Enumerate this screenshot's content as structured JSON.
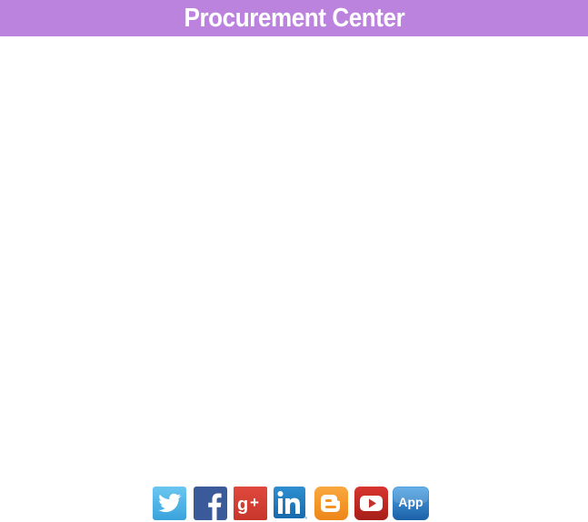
{
  "header": {
    "title": "Procurement Center",
    "background_color": "#bb82de",
    "text_color": "#ffffff"
  },
  "social_links": [
    {
      "name": "twitter",
      "icon": "twitter-icon",
      "color": "#4fb4e6"
    },
    {
      "name": "facebook",
      "icon": "facebook-icon",
      "color": "#3b5a9a"
    },
    {
      "name": "google-plus",
      "icon": "google-plus-icon",
      "color": "#d73d32",
      "label": "g+"
    },
    {
      "name": "linkedin",
      "icon": "linkedin-icon",
      "color": "#1f7bbf",
      "label": "in"
    },
    {
      "name": "blogger",
      "icon": "blogger-icon",
      "color": "#f39325"
    },
    {
      "name": "youtube",
      "icon": "youtube-icon",
      "color": "#c4302b"
    },
    {
      "name": "app",
      "icon": "app-icon",
      "color": "#2f7fc4",
      "label": "App"
    }
  ]
}
